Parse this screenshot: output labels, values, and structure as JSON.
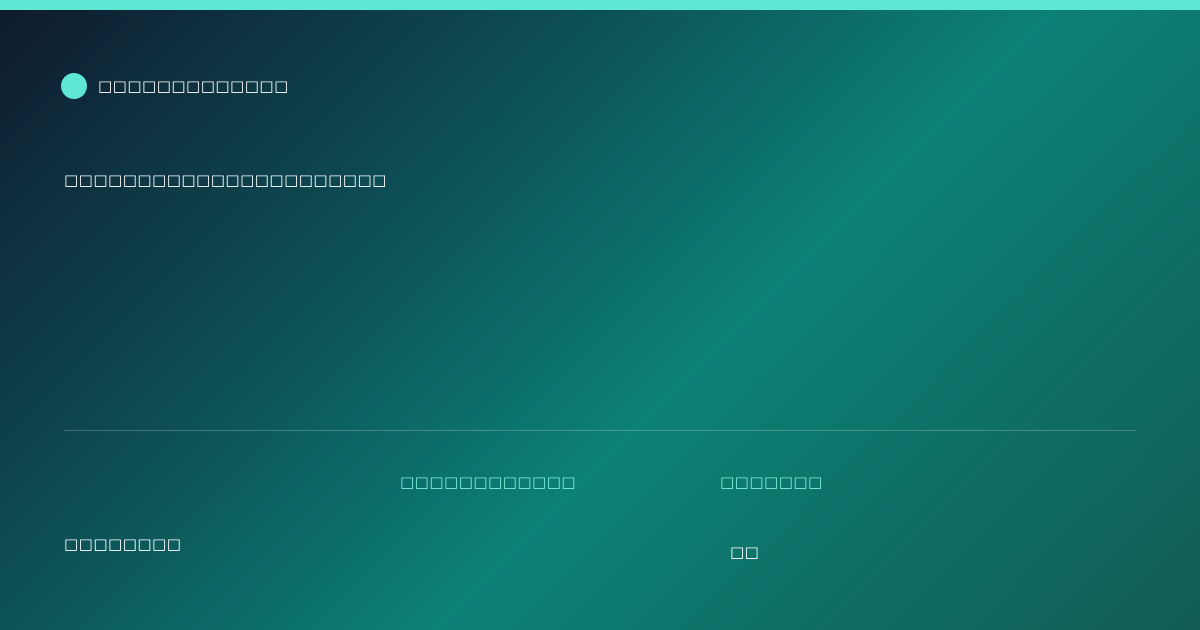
{
  "colors": {
    "accent": "#5ee8d3",
    "label": "#7df0dc",
    "text": "#ffffff"
  },
  "icons": {
    "brand": "brand-dot-icon"
  },
  "brand": {
    "name": "□□□□□□□□□□□□□"
  },
  "headline": "□□□□□□□□□□□□□□□□□□□□□□",
  "footer": {
    "left_text": "□□□□□□□□",
    "stats": [
      {
        "label": "□□□□□□□□□□□□"
      },
      {
        "label": "□□□□□□□",
        "value": "□□"
      }
    ]
  }
}
